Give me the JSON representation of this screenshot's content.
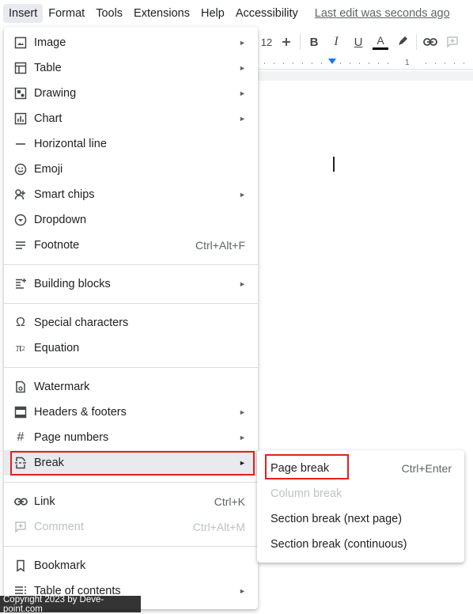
{
  "menubar": {
    "items": [
      "Insert",
      "Format",
      "Tools",
      "Extensions",
      "Help",
      "Accessibility"
    ],
    "last_edit": "Last edit was seconds ago"
  },
  "toolbar": {
    "font_size": "12",
    "ruler_number": "1"
  },
  "insert_menu": {
    "image": "Image",
    "table": "Table",
    "drawing": "Drawing",
    "chart": "Chart",
    "horizontal_line": "Horizontal line",
    "emoji": "Emoji",
    "smart_chips": "Smart chips",
    "dropdown": "Dropdown",
    "footnote": "Footnote",
    "footnote_shortcut": "Ctrl+Alt+F",
    "building_blocks": "Building blocks",
    "special_characters": "Special characters",
    "equation": "Equation",
    "watermark": "Watermark",
    "headers_footers": "Headers & footers",
    "page_numbers": "Page numbers",
    "break": "Break",
    "link": "Link",
    "link_shortcut": "Ctrl+K",
    "comment": "Comment",
    "comment_shortcut": "Ctrl+Alt+M",
    "bookmark": "Bookmark",
    "table_of_contents": "Table of contents"
  },
  "break_submenu": {
    "page_break": "Page break",
    "page_break_shortcut": "Ctrl+Enter",
    "column_break": "Column break",
    "section_break_next": "Section break (next page)",
    "section_break_continuous": "Section break (continuous)"
  },
  "watermark_text": "Copyright 2023 by Deve-point.com",
  "colors": {
    "highlight_box": "#e3201b",
    "accent": "#1a73e8",
    "disabled_text": "#bdc1c6"
  },
  "icons": [
    "image-icon",
    "table-icon",
    "drawing-icon",
    "chart-icon",
    "horizontal-line-icon",
    "emoji-icon",
    "smart-chips-icon",
    "dropdown-icon",
    "footnote-icon",
    "building-blocks-icon",
    "special-characters-icon",
    "equation-icon",
    "watermark-icon",
    "headers-footers-icon",
    "page-numbers-icon",
    "break-icon",
    "link-icon",
    "comment-icon",
    "bookmark-icon",
    "table-of-contents-icon"
  ]
}
